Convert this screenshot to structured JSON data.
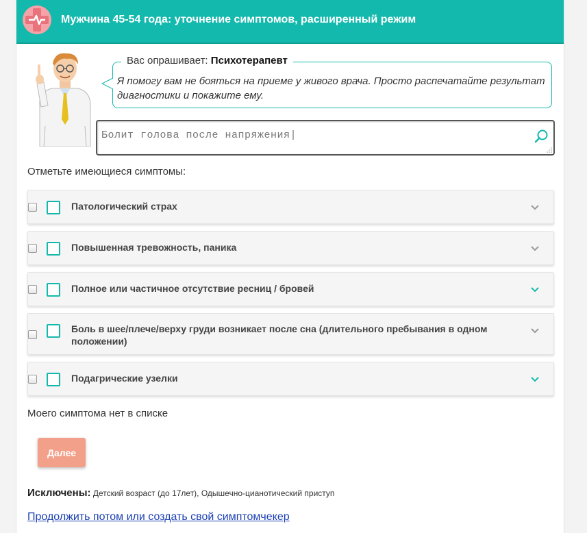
{
  "header": {
    "title": "Мужчина 45-54 года: уточнение симптомов, расширенный режим",
    "brand_color": "#14b9ad"
  },
  "assistant": {
    "asker_prefix": "Вас опрашивает:",
    "asker_role": "Психотерапевт",
    "message": "Я помогу вам не бояться на приеме у живого врача. Просто распечатайте результат диагностики и покажите ему."
  },
  "search": {
    "value": "Болит голова после напряжения|",
    "icon": "search-icon"
  },
  "symptoms_title": "Отметьте имеющиеся симптомы:",
  "symptoms": [
    {
      "label": "Патологический страх",
      "chevron_color": "#999999"
    },
    {
      "label": "Повышенная тревожность, паника",
      "chevron_color": "#999999"
    },
    {
      "label": "Полное или частичное отсутствие ресниц / бровей",
      "chevron_color": "#14b9ad"
    },
    {
      "label": "Боль в шее/плече/верху груди возникает после сна (длительного пребывания в одном положении)",
      "chevron_color": "#999999"
    },
    {
      "label": "Подагрические узелки",
      "chevron_color": "#14b9ad"
    }
  ],
  "no_symptom_link": "Моего симптома нет в списке",
  "next_button": "Далее",
  "excluded": {
    "label": "Исключены:",
    "text": "Детский возраст (до 17лет), Одышечно-цианотический приступ"
  },
  "continue_link": "Продолжить потом или создать свой симптомчекер",
  "colors": {
    "accent": "#14b9ad",
    "next_button": "#f3a08a",
    "link": "#1a3fb3"
  }
}
